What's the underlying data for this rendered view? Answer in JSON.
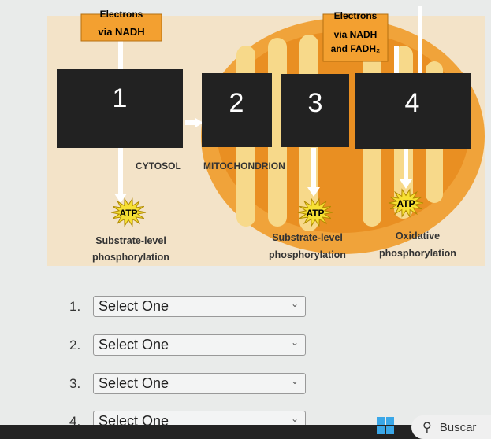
{
  "diagram": {
    "electron_label_1": [
      "Electrons",
      "via NADH"
    ],
    "electron_label_2": [
      "Electrons",
      "via NADH",
      "and FADH₂"
    ],
    "boxes": [
      "1",
      "2",
      "3",
      "4"
    ],
    "region_labels": [
      "CYTOSOL",
      "MITOCHONDRION"
    ],
    "atp": "ATP",
    "outputs": [
      [
        "Substrate-level",
        "phosphorylation"
      ],
      [
        "Substrate-level",
        "phosphorylation"
      ],
      [
        "Oxidative",
        "phosphorylation"
      ]
    ],
    "colors": {
      "background": "#f3e3c8",
      "mito_outer": "#f0a33a",
      "mito_inner": "#f7d98a",
      "label_box": "#f3a030",
      "box": "#222222",
      "atp": "#f7e034"
    }
  },
  "questions": [
    {
      "number": "1.",
      "value": "Select One"
    },
    {
      "number": "2.",
      "value": "Select One"
    },
    {
      "number": "3.",
      "value": "Select One"
    },
    {
      "number": "4.",
      "value": "Select One"
    }
  ],
  "taskbar": {
    "search_label": "Buscar",
    "icons": [
      "windows-start-icon",
      "search-icon"
    ]
  }
}
